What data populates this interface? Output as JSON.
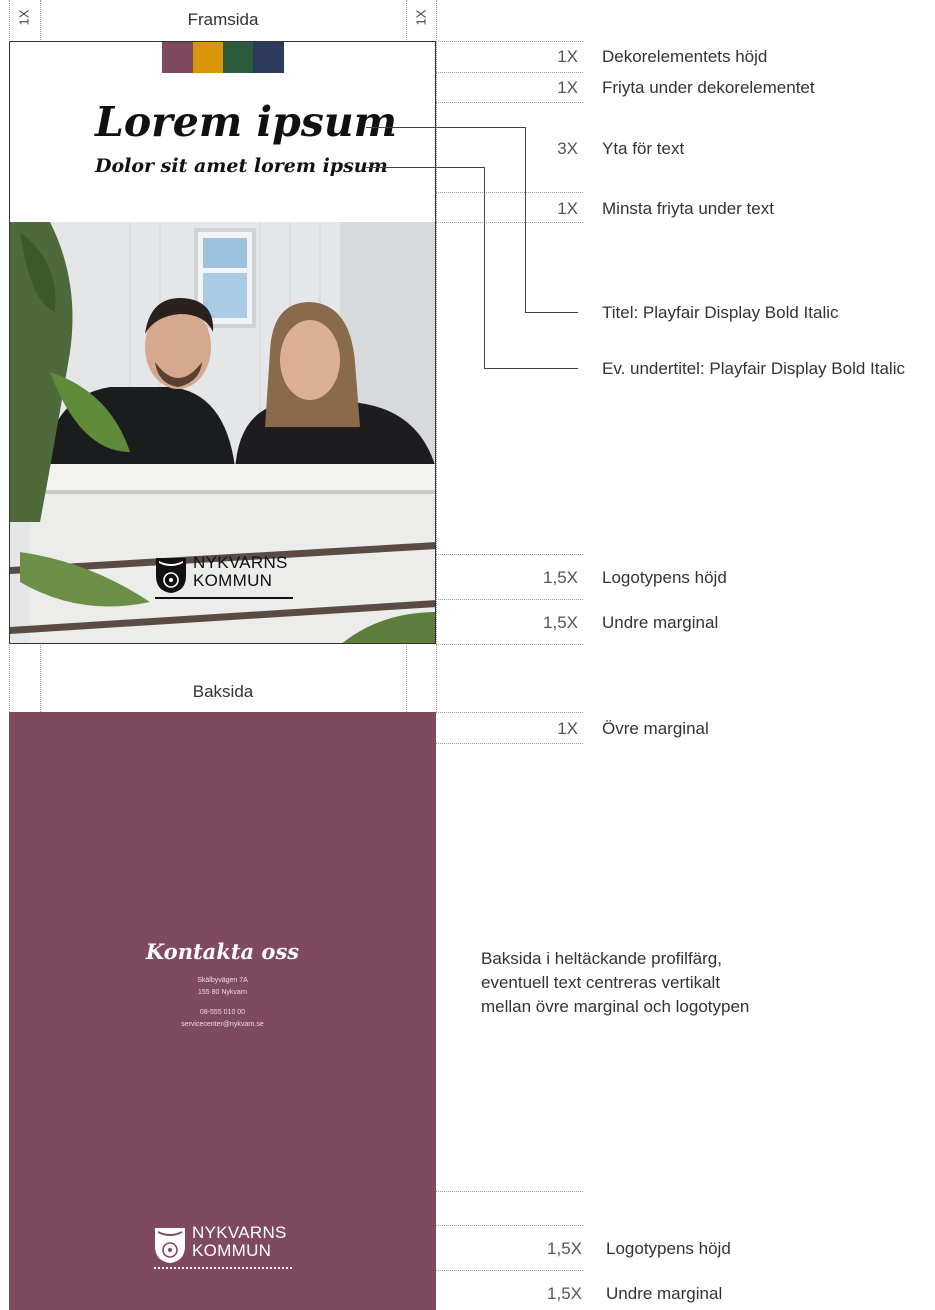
{
  "labels": {
    "margin_left": "1X",
    "margin_right": "1X",
    "front": "Framsida",
    "back": "Baksida"
  },
  "front": {
    "swatch_colors": [
      "#7f4a5f",
      "#d9960b",
      "#2d5a3d",
      "#2e3a5c"
    ],
    "title": "Lorem ipsum",
    "subtitle": "Dolor sit amet lorem ipsum",
    "logo_line1": "NYKVARNS",
    "logo_line2": "KOMMUN"
  },
  "measures": [
    {
      "mult": "1X",
      "label": "Dekorelementets höjd"
    },
    {
      "mult": "1X",
      "label": "Friyta under dekorelementet"
    },
    {
      "mult": "3X",
      "label": "Yta för text"
    },
    {
      "mult": "1X",
      "label": "Minsta friyta under text"
    },
    {
      "mult": "1,5X",
      "label": "Logotypens höjd"
    },
    {
      "mult": "1,5X",
      "label": "Undre marginal"
    },
    {
      "mult": "1X",
      "label": "Övre marginal"
    },
    {
      "mult": "1,5X",
      "label": "Logotypens höjd"
    },
    {
      "mult": "1,5X",
      "label": "Undre marginal"
    }
  ],
  "fonts": {
    "title_note": "Titel: Playfair Display Bold Italic",
    "subtitle_note": "Ev. undertitel: Playfair Display Bold Italic"
  },
  "back": {
    "title": "Kontakta oss",
    "address1": "Skälbyvägen 7A",
    "address2": "155 80 Nykvarn",
    "phone": "08-555 010 00",
    "email": "servicecenter@nykvarn.se",
    "logo_line1": "NYKVARNS",
    "logo_line2": "KOMMUN",
    "color": "#7f4a5f"
  },
  "back_info": {
    "line1": "Baksida i heltäckande profilfärg,",
    "line2": "eventuell text centreras vertikalt",
    "line3": "mellan övre marginal och logotypen"
  }
}
